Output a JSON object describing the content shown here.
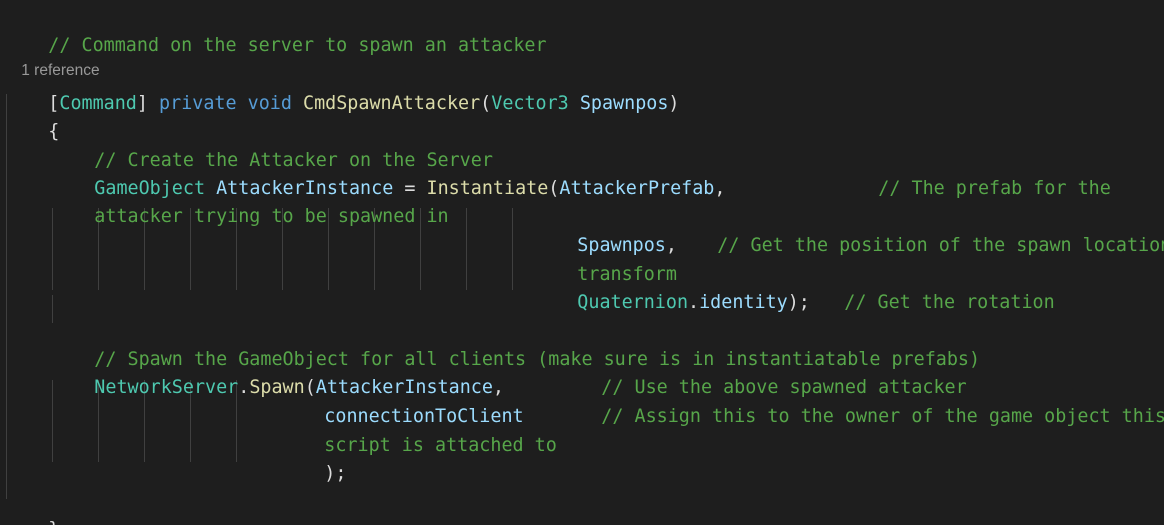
{
  "editor": {
    "colors": {
      "background": "#1e1e1e",
      "comment": "#57a64a",
      "keyword": "#569cd6",
      "type": "#4ec9b0",
      "method": "#dcdcaa",
      "identifier": "#9cdcfe",
      "text": "#dcdcdc",
      "codelens": "#999999"
    },
    "line1": {
      "comment": "// Command on the server to spawn an attacker"
    },
    "codelens": "1 reference",
    "signature": {
      "bracket_open": "[",
      "attribute": "Command",
      "bracket_close": "]",
      "kw_private": "private",
      "kw_void": "void",
      "method": "CmdSpawnAttacker",
      "paren_open": "(",
      "param_type": "Vector3",
      "param_name": "Spawnpos",
      "paren_close": ")"
    },
    "brace_open": "{",
    "comment_create": "// Create the Attacker on the Server",
    "instantiate": {
      "type": "GameObject",
      "var": "AttackerInstance",
      "eq": "=",
      "method": "Instantiate",
      "paren": "(",
      "arg": "AttackerPrefab",
      "comma": ",",
      "comment_part1": "// The prefab for the",
      "comment_part2": "attacker trying to be spawned in"
    },
    "spawnpos_line": {
      "arg": "Spawnpos",
      "comma": ",",
      "comment_part1": "// Get the position of the spawn location",
      "comment_part2": "transform"
    },
    "quaternion_line": {
      "type": "Quaternion",
      "dot": ".",
      "member": "identity",
      "close": ");",
      "comment": "// Get the rotation"
    },
    "comment_spawn": "// Spawn the GameObject for all clients (make sure is in instantiatable prefabs)",
    "spawn_call": {
      "type": "NetworkServer",
      "dot": ".",
      "method": "Spawn",
      "paren": "(",
      "arg": "AttackerInstance",
      "comma": ",",
      "comment": "// Use the above spawned attacker"
    },
    "connection_line": {
      "arg": "connectionToClient",
      "comment_part1": "// Assign this to the owner of the game object this",
      "comment_part2": "script is attached to"
    },
    "close_call": ");",
    "brace_close": "}"
  }
}
